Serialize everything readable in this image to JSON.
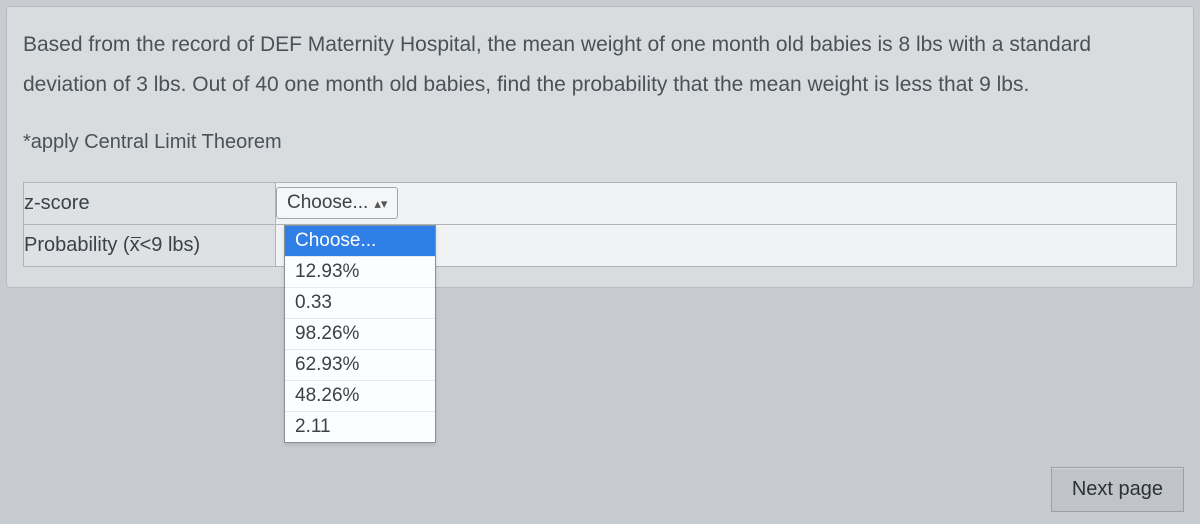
{
  "question": {
    "prompt": "Based from the record of DEF Maternity Hospital, the mean weight of one month old babies is 8 lbs with a standard deviation of 3 lbs. Out of 40 one month old babies, find the probability that the mean weight is less that 9 lbs.",
    "hint": "*apply Central Limit Theorem"
  },
  "rows": {
    "zscore": {
      "label": "z-score",
      "select_label": "Choose..."
    },
    "probability": {
      "label_prefix": "Probability (",
      "label_var": "x",
      "label_suffix": "<9 lbs)"
    }
  },
  "dropdown": {
    "options": [
      {
        "label": "Choose...",
        "selected": true
      },
      {
        "label": "12.93%",
        "selected": false
      },
      {
        "label": "0.33",
        "selected": false
      },
      {
        "label": "98.26%",
        "selected": false
      },
      {
        "label": "62.93%",
        "selected": false
      },
      {
        "label": "48.26%",
        "selected": false
      },
      {
        "label": "2.11",
        "selected": false
      }
    ]
  },
  "nav": {
    "next": "Next page"
  }
}
